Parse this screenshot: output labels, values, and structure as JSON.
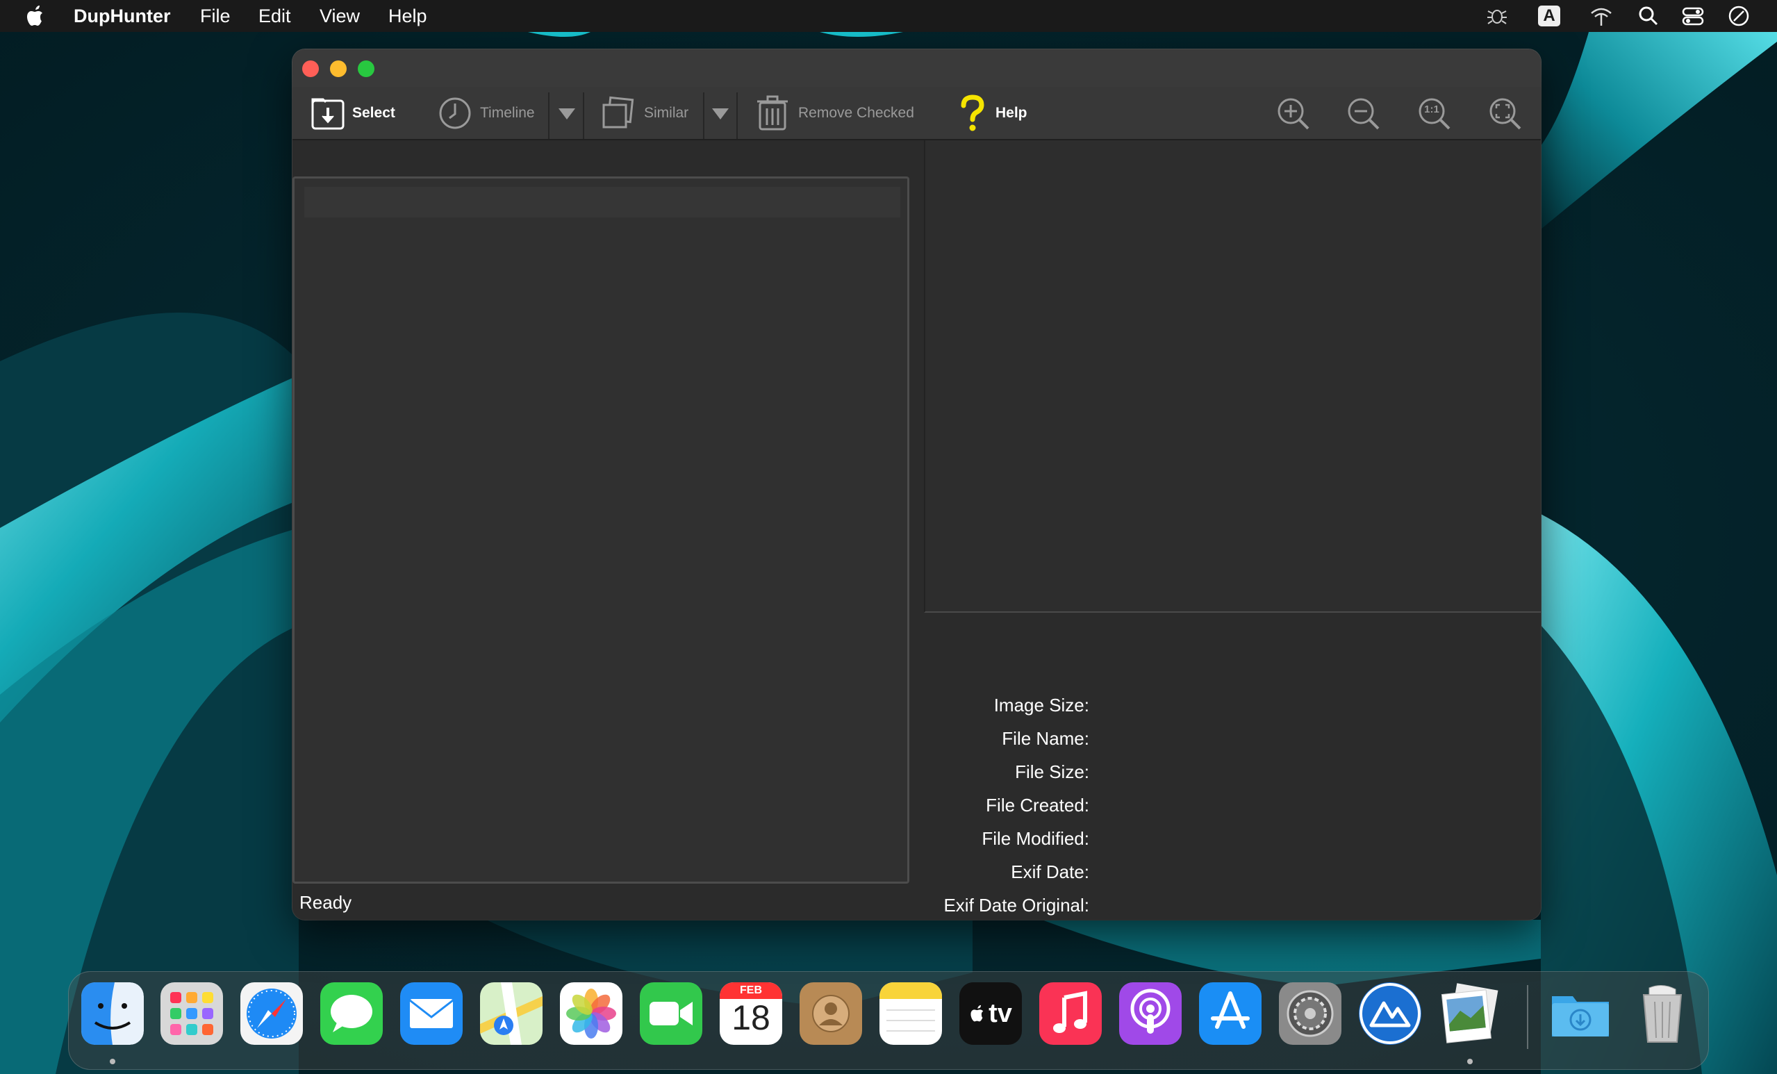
{
  "menubar": {
    "app_name": "DupHunter",
    "items": [
      "File",
      "Edit",
      "View",
      "Help"
    ],
    "status_icons": [
      "bug-icon",
      "input-source-icon",
      "wifi-icon",
      "spotlight-search-icon",
      "control-center-icon",
      "siri-icon"
    ],
    "input_source_label": "A"
  },
  "toolbar": {
    "select_label": "Select",
    "timeline_label": "Timeline",
    "similar_label": "Similar",
    "remove_label": "Remove Checked",
    "help_label": "Help",
    "zoom_actual_label": "1:1"
  },
  "info": {
    "image_size": "Image Size:",
    "file_name": "File Name:",
    "file_size": "File Size:",
    "file_created": "File Created:",
    "file_modified": "File Modified:",
    "exif_date": "Exif Date:",
    "exif_date_original": "Exif Date Original:"
  },
  "status": "Ready",
  "dock": {
    "apps": [
      "Finder",
      "Launchpad",
      "Safari",
      "Messages",
      "Mail",
      "Maps",
      "Photos",
      "FaceTime",
      "Calendar",
      "Contacts",
      "Notes",
      "TV",
      "Music",
      "Podcasts",
      "App Store",
      "System Preferences",
      "DupHunter",
      "Preview",
      "Downloads",
      "Trash"
    ],
    "calendar_month": "FEB",
    "calendar_day": "18",
    "tv_label": "tv"
  },
  "colors": {
    "accent_help": "#f5e400",
    "close": "#ff5f57",
    "minimize": "#febc2e",
    "zoom": "#28c840"
  }
}
